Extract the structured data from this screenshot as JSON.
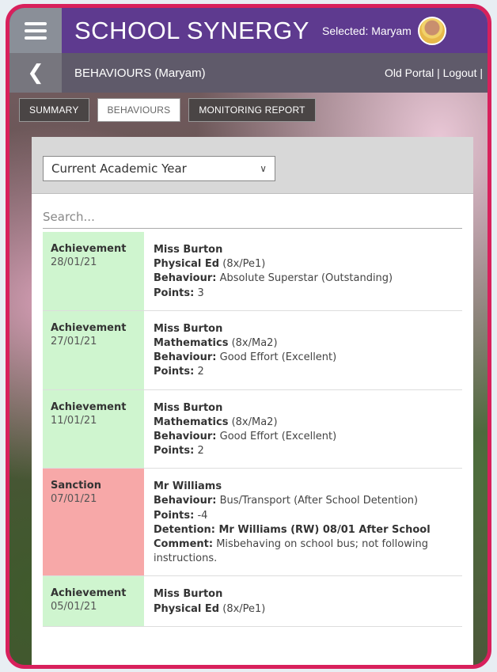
{
  "header": {
    "brand": "SCHOOL SYNERGY",
    "selected": "Selected: Maryam",
    "page_title": "BEHAVIOURS (Maryam)",
    "portal_links": "Old Portal | Logout |"
  },
  "tabs": [
    {
      "label": "SUMMARY"
    },
    {
      "label": "BEHAVIOURS"
    },
    {
      "label": "MONITORING REPORT"
    }
  ],
  "filter": {
    "selected": "Current Academic Year"
  },
  "search": {
    "placeholder": "Search..."
  },
  "records": [
    {
      "type": "Achievement",
      "date": "28/01/21",
      "teacher": "Miss Burton",
      "subject": "Physical Ed",
      "group": "(8x/Pe1)",
      "behaviour_label": "Behaviour:",
      "behaviour": "Absolute Superstar (Outstanding)",
      "points_label": "Points:",
      "points": "3"
    },
    {
      "type": "Achievement",
      "date": "27/01/21",
      "teacher": "Miss Burton",
      "subject": "Mathematics",
      "group": "(8x/Ma2)",
      "behaviour_label": "Behaviour:",
      "behaviour": "Good Effort (Excellent)",
      "points_label": "Points:",
      "points": "2"
    },
    {
      "type": "Achievement",
      "date": "11/01/21",
      "teacher": "Miss Burton",
      "subject": "Mathematics",
      "group": "(8x/Ma2)",
      "behaviour_label": "Behaviour:",
      "behaviour": "Good Effort (Excellent)",
      "points_label": "Points:",
      "points": "2"
    },
    {
      "type": "Sanction",
      "date": "07/01/21",
      "teacher": "Mr Williams",
      "behaviour_label": "Behaviour:",
      "behaviour": "Bus/Transport (After School Detention)",
      "points_label": "Points:",
      "points": "-4",
      "detention_label": "Detention:",
      "detention": "Mr Williams (RW) 08/01 After School",
      "comment_label": "Comment:",
      "comment": "Misbehaving on school bus; not following instructions."
    },
    {
      "type": "Achievement",
      "date": "05/01/21",
      "teacher": "Miss Burton",
      "subject": "Physical Ed",
      "group": "(8x/Pe1)"
    }
  ],
  "colors": {
    "frame": "#d8205c",
    "topbar": "#5e3a8f",
    "achievement": "#cff5cf",
    "sanction": "#f7a8a8"
  },
  "icons": {
    "menu": "hamburger-menu-icon",
    "back": "chevron-left-icon",
    "dropdown": "chevron-down-icon"
  }
}
